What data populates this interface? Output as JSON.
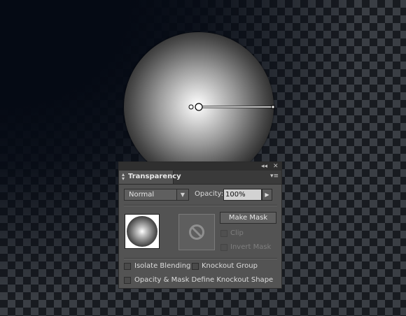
{
  "panel": {
    "title": "Transparency",
    "blend_mode": "Normal",
    "opacity_label": "Opacity:",
    "opacity_value": "100%",
    "make_mask_label": "Make Mask",
    "clip_label": "Clip",
    "invert_mask_label": "Invert Mask",
    "isolate_blending_label": "Isolate Blending",
    "knockout_group_label": "Knockout Group",
    "opacity_mask_define_label": "Opacity & Mask Define Knockout Shape",
    "collapse_glyph": "◂◂",
    "close_glyph": "✕",
    "menu_glyph": "▾≡"
  },
  "icons": {
    "collapse": "collapse-icon",
    "close": "close-icon",
    "panel_menu": "panel-menu-icon",
    "no_mask": "no-mask-icon"
  },
  "colors": {
    "panel_bg": "#535353",
    "tab_bar": "#3a3a3a",
    "input_bg": "#d2d2d2"
  }
}
